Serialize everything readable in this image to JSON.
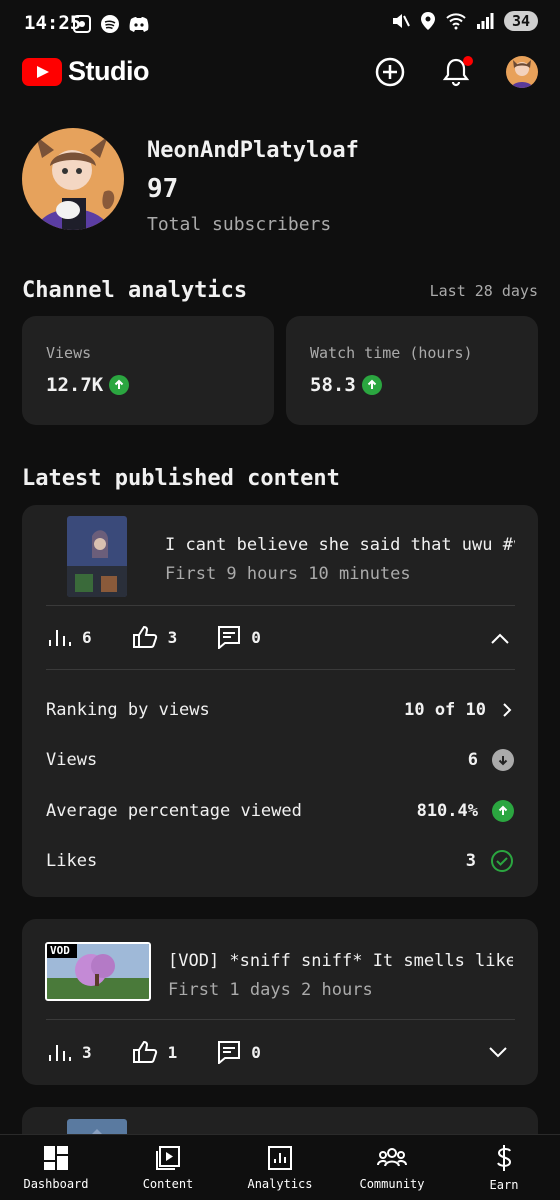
{
  "status_bar": {
    "time": "14:25",
    "battery": "34"
  },
  "app": {
    "logo_text": "Studio"
  },
  "channel": {
    "name": "NeonAndPlatyloaf",
    "subscribers": "97",
    "subscribers_label": "Total subscribers"
  },
  "analytics": {
    "title": "Channel analytics",
    "period": "Last 28 days",
    "cards": [
      {
        "label": "Views",
        "value": "12.7K",
        "trend": "up"
      },
      {
        "label": "Watch time (hours)",
        "value": "58.3",
        "trend": "up"
      }
    ]
  },
  "latest": {
    "title": "Latest published content",
    "items": [
      {
        "title": "I cant believe she said that uwu #vtube…",
        "subtitle": "First 9 hours 10 minutes",
        "views": "6",
        "likes": "3",
        "comments": "0",
        "details": [
          {
            "label": "Ranking by views",
            "value": "10 of 10"
          },
          {
            "label": "Views",
            "value": "6"
          },
          {
            "label": "Average percentage viewed",
            "value": "810.4%"
          },
          {
            "label": "Likes",
            "value": "3"
          }
        ]
      },
      {
        "title": "[VOD] *sniff sniff* It smells like a nye…",
        "subtitle": "First 1 days 2 hours",
        "thumb_text": "VOD",
        "views": "3",
        "likes": "1",
        "comments": "0"
      }
    ]
  },
  "nav": [
    {
      "label": "Dashboard",
      "icon": "dashboard-icon"
    },
    {
      "label": "Content",
      "icon": "content-icon"
    },
    {
      "label": "Analytics",
      "icon": "analytics-icon"
    },
    {
      "label": "Community",
      "icon": "community-icon"
    },
    {
      "label": "Earn",
      "icon": "earn-icon"
    }
  ],
  "colors": {
    "bg": "#0f0f0f",
    "card": "#212121",
    "brand": "#ff0000",
    "positive": "#2ba640"
  }
}
